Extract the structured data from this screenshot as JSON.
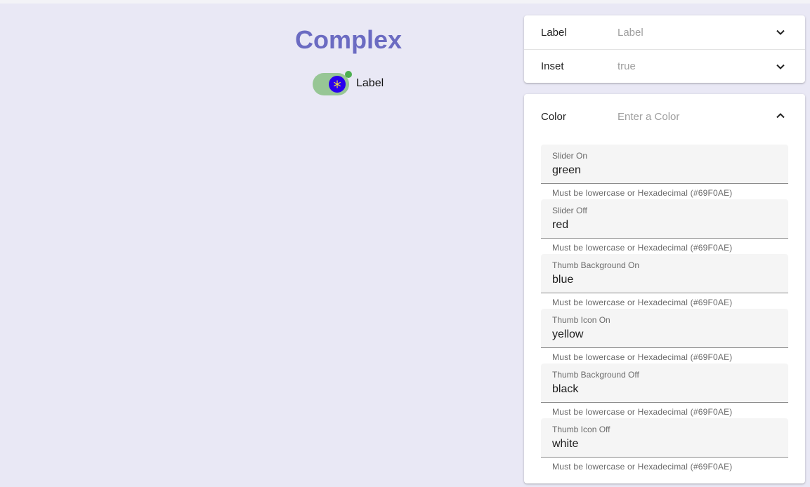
{
  "preview": {
    "title": "Complex",
    "switch_label": "Label",
    "switch_checked": true,
    "colors": {
      "slider_on": "#97c695",
      "thumb_on": "#2a00ee",
      "thumb_icon": "#f5e23a",
      "badge": "#4caf50"
    }
  },
  "controls": {
    "label_row": {
      "label": "Label",
      "value": "Label"
    },
    "inset_row": {
      "label": "Inset",
      "value": "true"
    },
    "color_section": {
      "label": "Color",
      "placeholder": "Enter a Color",
      "fields": [
        {
          "label": "Slider On",
          "value": "green",
          "hint": "Must be lowercase or Hexadecimal (#69F0AE)"
        },
        {
          "label": "Slider Off",
          "value": "red",
          "hint": "Must be lowercase or Hexadecimal (#69F0AE)"
        },
        {
          "label": "Thumb Background On",
          "value": "blue",
          "hint": "Must be lowercase or Hexadecimal (#69F0AE)"
        },
        {
          "label": "Thumb Icon On",
          "value": "yellow",
          "hint": "Must be lowercase or Hexadecimal (#69F0AE)"
        },
        {
          "label": "Thumb Background Off",
          "value": "black",
          "hint": "Must be lowercase or Hexadecimal (#69F0AE)"
        },
        {
          "label": "Thumb Icon Off",
          "value": "white",
          "hint": "Must be lowercase or Hexadecimal (#69F0AE)"
        }
      ]
    }
  }
}
